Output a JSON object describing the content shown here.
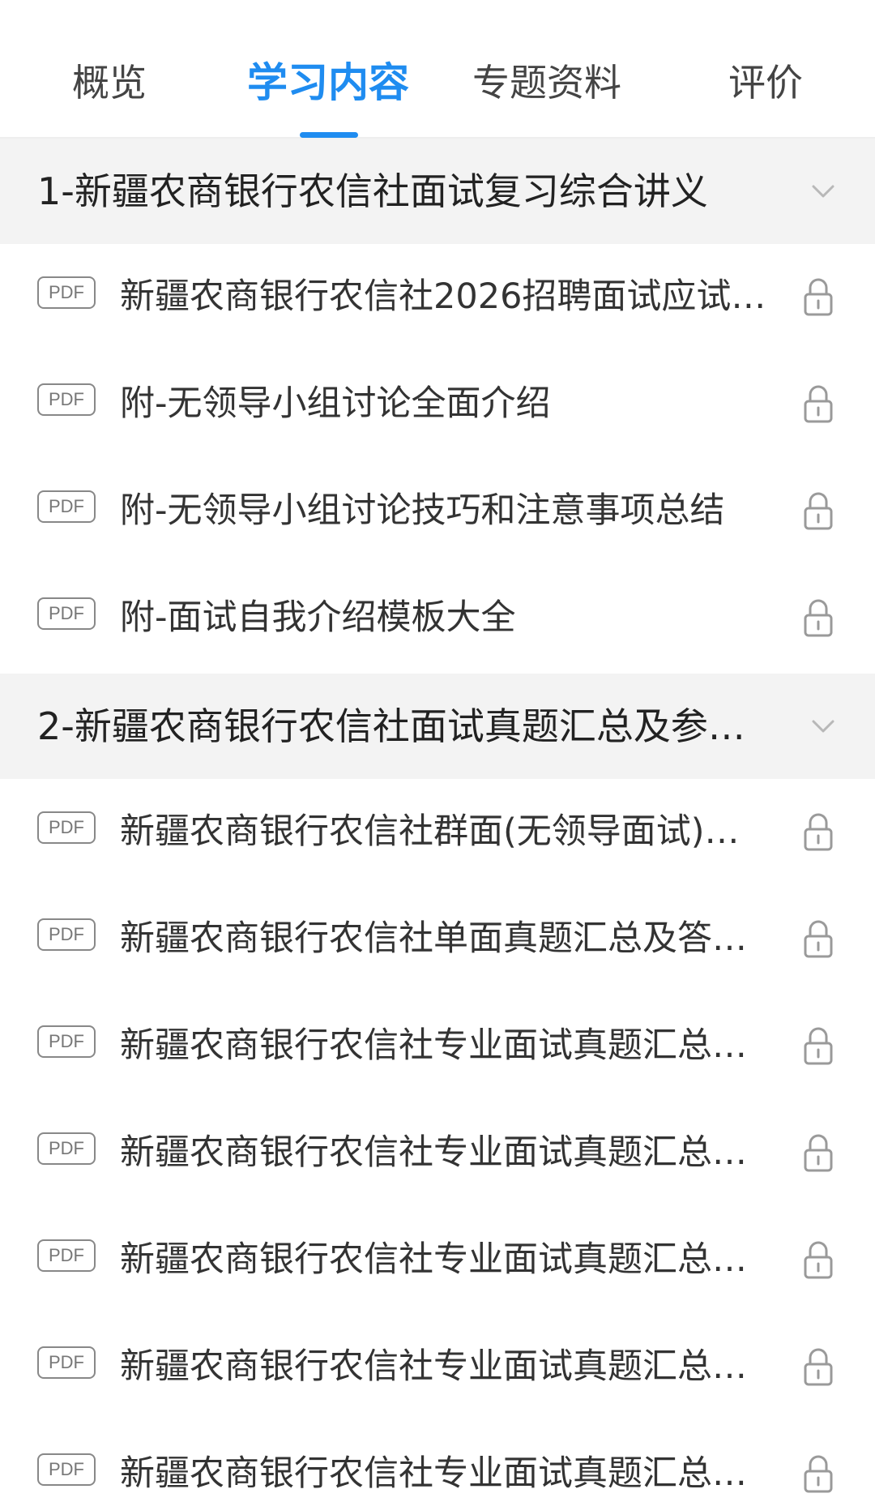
{
  "tabs": [
    {
      "label": "概览",
      "active": false
    },
    {
      "label": "学习内容",
      "active": true
    },
    {
      "label": "专题资料",
      "active": false
    },
    {
      "label": "评价",
      "active": false
    }
  ],
  "colors": {
    "accent": "#1f8cf0",
    "section_bg": "#f3f3f3",
    "icon_gray": "#999999"
  },
  "sections": [
    {
      "title": "1-新疆农商银行农信社面试复习综合讲义",
      "items": [
        {
          "badge": "PDF",
          "title": "新疆农商银行农信社2026招聘面试应试…",
          "icon": "lock-icon"
        },
        {
          "badge": "PDF",
          "title": "附-无领导小组讨论全面介绍",
          "icon": "lock-icon"
        },
        {
          "badge": "PDF",
          "title": "附-无领导小组讨论技巧和注意事项总结",
          "icon": "lock-icon"
        },
        {
          "badge": "PDF",
          "title": "附-面试自我介绍模板大全",
          "icon": "lock-icon"
        }
      ]
    },
    {
      "title": "2-新疆农商银行农信社面试真题汇总及参…",
      "items": [
        {
          "badge": "PDF",
          "title": "新疆农商银行农信社群面(无领导面试)…",
          "icon": "lock-icon"
        },
        {
          "badge": "PDF",
          "title": "新疆农商银行农信社单面真题汇总及答…",
          "icon": "lock-icon"
        },
        {
          "badge": "PDF",
          "title": "新疆农商银行农信社专业面试真题汇总…",
          "icon": "lock-icon"
        },
        {
          "badge": "PDF",
          "title": "新疆农商银行农信社专业面试真题汇总…",
          "icon": "lock-icon"
        },
        {
          "badge": "PDF",
          "title": "新疆农商银行农信社专业面试真题汇总…",
          "icon": "lock-icon"
        },
        {
          "badge": "PDF",
          "title": "新疆农商银行农信社专业面试真题汇总…",
          "icon": "lock-icon"
        },
        {
          "badge": "PDF",
          "title": "新疆农商银行农信社专业面试真题汇总…",
          "icon": "lock-icon"
        }
      ]
    }
  ]
}
